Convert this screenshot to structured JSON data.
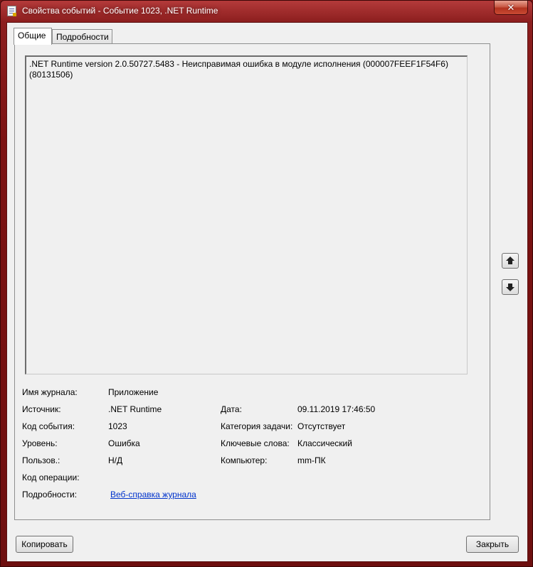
{
  "window": {
    "title": "Свойства событий - Событие 1023, .NET Runtime",
    "close_label": "✕",
    "icon": "event-properties-icon"
  },
  "tabs": [
    {
      "label": "Общие",
      "selected": true
    },
    {
      "label": "Подробности",
      "selected": false
    }
  ],
  "description": ".NET Runtime version 2.0.50727.5483 - Неисправимая ошибка в модуле исполнения (000007FEEF1F54F6)\n(80131506)",
  "fields": {
    "log_name": {
      "label": "Имя журнала:",
      "value": "Приложение"
    },
    "source": {
      "label": "Источник:",
      "value": ".NET Runtime"
    },
    "event_id": {
      "label": "Код события:",
      "value": "1023"
    },
    "level": {
      "label": "Уровень:",
      "value": "Ошибка"
    },
    "user": {
      "label": "Пользов.:",
      "value": "Н/Д"
    },
    "opcode": {
      "label": "Код операции:",
      "value": ""
    },
    "more_info": {
      "label": "Подробности:",
      "value": "Веб-справка журнала"
    },
    "logged": {
      "label": "Дата:",
      "value": "09.11.2019 17:46:50"
    },
    "task_category": {
      "label": "Категория задачи:",
      "value": "Отсутствует"
    },
    "keywords": {
      "label": "Ключевые слова:",
      "value": "Классический"
    },
    "computer": {
      "label": "Компьютер:",
      "value": "mm-ПК"
    }
  },
  "buttons": {
    "copy": "Копировать",
    "close": "Закрыть"
  },
  "icons": {
    "prev": "arrow-up-icon",
    "next": "arrow-down-icon"
  }
}
